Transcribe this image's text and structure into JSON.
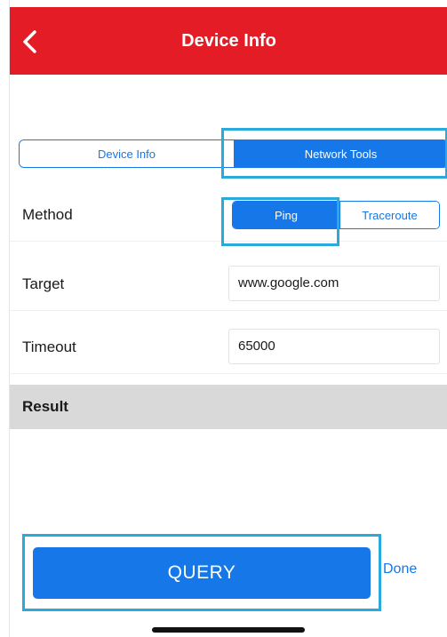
{
  "header": {
    "title": "Device Info",
    "back_icon": "chevron-left-icon"
  },
  "tabs": [
    {
      "label": "Device Info",
      "selected": false
    },
    {
      "label": "Network Tools",
      "selected": true
    }
  ],
  "form": {
    "method": {
      "label": "Method",
      "options": [
        {
          "label": "Ping",
          "selected": true
        },
        {
          "label": "Traceroute",
          "selected": false
        }
      ]
    },
    "target": {
      "label": "Target",
      "value": "www.google.com"
    },
    "timeout": {
      "label": "Timeout",
      "value": "65000"
    }
  },
  "result": {
    "label": "Result",
    "text": ""
  },
  "actions": {
    "query_label": "QUERY",
    "done_label": "Done"
  },
  "colors": {
    "navbar": "#e31c25",
    "accent": "#1677e8",
    "highlight": "#2aa9dc",
    "result_header": "#d9d9d9"
  }
}
